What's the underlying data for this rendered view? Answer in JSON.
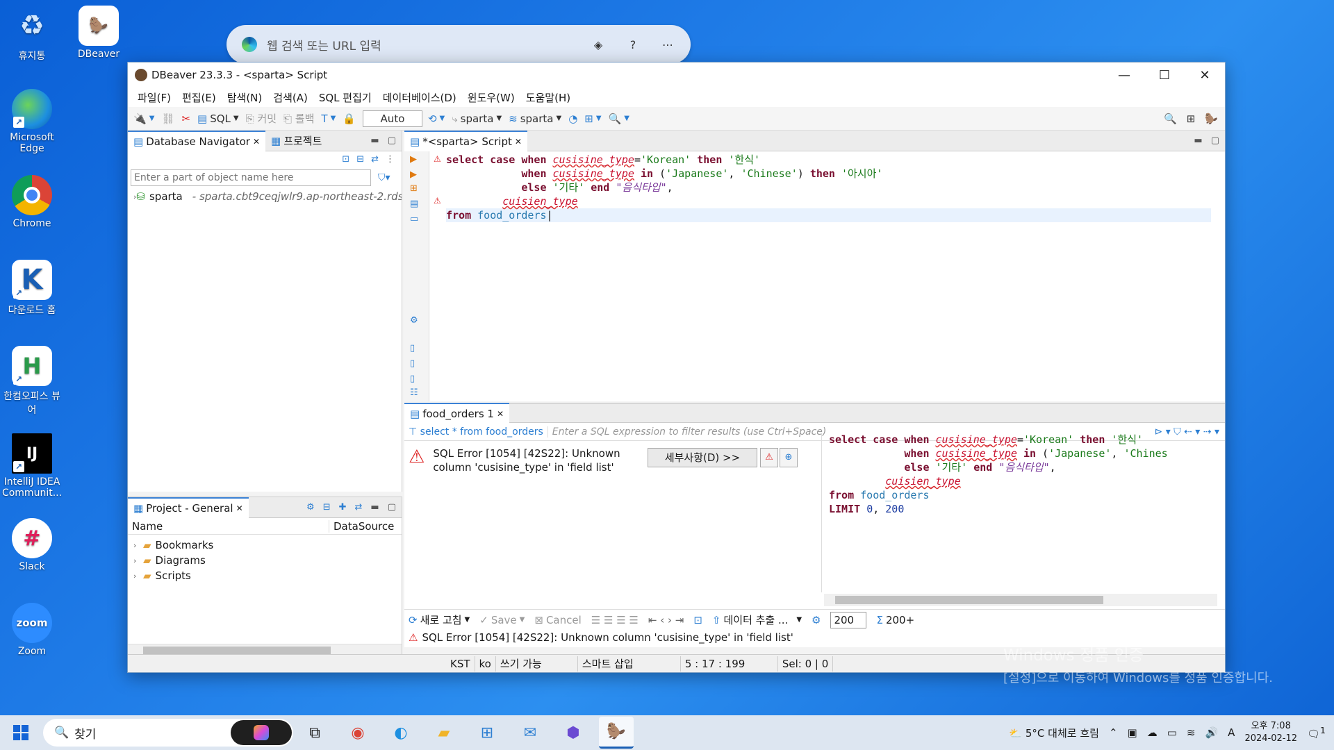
{
  "desktop": {
    "icons": [
      {
        "label": "휴지통"
      },
      {
        "label": "DBeaver"
      },
      {
        "label": "Microsoft Edge"
      },
      {
        "label": "Chrome"
      },
      {
        "label": "다운로드 홈"
      },
      {
        "label": "한컴오피스 뷰어"
      },
      {
        "label": "IntelliJ IDEA Communit..."
      },
      {
        "label": "Slack"
      },
      {
        "label": "Zoom"
      }
    ]
  },
  "edge_bar": {
    "placeholder": "웹 검색 또는 URL 입력"
  },
  "window": {
    "title": "DBeaver 23.3.3 - <sparta> Script",
    "menu": [
      "파일(F)",
      "편집(E)",
      "탐색(N)",
      "검색(A)",
      "SQL 편집기",
      "데이터베이스(D)",
      "윈도우(W)",
      "도움말(H)"
    ],
    "toolbar": {
      "sql": "SQL",
      "commit": "커밋",
      "rollback": "롤백",
      "auto": "Auto",
      "datasource": "sparta",
      "schema": "sparta"
    }
  },
  "navigator": {
    "tab_db": "Database Navigator",
    "tab_project": "프로젝트",
    "filter_placeholder": "Enter a part of object name here",
    "tree": [
      {
        "name": "sparta",
        "host": "- sparta.cbt9ceqjwlr9.ap-northeast-2.rds.ama"
      }
    ]
  },
  "project_panel": {
    "tab": "Project - General",
    "col_name": "Name",
    "col_ds": "DataSource",
    "items": [
      "Bookmarks",
      "Diagrams",
      "Scripts"
    ]
  },
  "editor": {
    "tab": "*<sparta> Script",
    "lines": [
      "select case when cusisine_type='Korean' then '한식'",
      "            when cusisine_type in ('Japanese', 'Chinese') then '아시아'",
      "            else '기타' end \"음식타입\",",
      "         cuisien_type",
      "from food_orders"
    ]
  },
  "results": {
    "tab": "food_orders 1",
    "query_label": "select * from food_orders",
    "filter_placeholder": "Enter a SQL expression to filter results (use Ctrl+Space)",
    "error_message": "SQL Error [1054] [42S22]: Unknown column 'cusisine_type' in 'field list'",
    "details_button": "세부사항(D) >>",
    "code_lines": [
      "select case when cusisine_type='Korean' then '한식'",
      "            when cusisine_type in ('Japanese', 'Chines",
      "            else '기타' end \"음식타입\",",
      "         cuisien_type",
      "from food_orders",
      "LIMIT 0, 200"
    ],
    "toolbar": {
      "refresh": "새로 고침",
      "save": "Save",
      "cancel": "Cancel",
      "export": "데이터 추출 ...",
      "limit": "200",
      "count": "200+"
    },
    "status_error": "SQL Error [1054] [42S22]: Unknown column 'cusisine_type' in 'field list'"
  },
  "statusbar": {
    "tz": "KST",
    "locale": "ko",
    "writable": "쓰기 가능",
    "insert": "스마트 삽입",
    "position": "5 : 17 : 199",
    "sel": "Sel: 0 | 0"
  },
  "watermark": {
    "line1": "Windows 정품 인증",
    "line2": "[설정]으로 이동하여 Windows를 정품 인증합니다."
  },
  "taskbar": {
    "search": "찾기",
    "weather": "5°C 대체로 흐림",
    "time": "오후 7:08",
    "date": "2024-02-12",
    "notif": "1"
  }
}
